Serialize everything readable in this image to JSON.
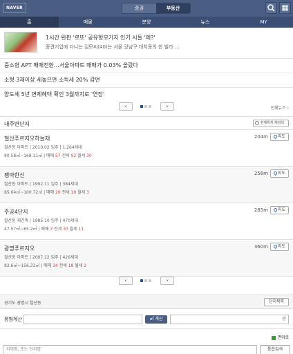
{
  "header": {
    "logo": "NAVER",
    "segment": [
      "증권",
      "부동산"
    ],
    "icons": [
      "search-icon",
      "grid-menu-icon"
    ]
  },
  "tabs": [
    "홈",
    "매물",
    "분양",
    "뉴스",
    "MY"
  ],
  "news": {
    "featured_title": "1시간 완판 '로또' 공유형모기지 인기 시들 '왜?'",
    "featured_sub": "중견기업에 다니는 김모씨(40)는 서울 강남구 대치동의 한 빌라 ...",
    "headlines": [
      "중소형 APT 매매전환…서울아파트 매매가 0.03% 올랐다",
      "소형 3채이상 세놓으면 소득세 20% 감면",
      "양도세 5년 면제혜택 확인 3월까지로 '연장'"
    ],
    "more": "전체뉴스"
  },
  "section": {
    "title": "내주변단지",
    "loc_button": "현재위치 재검색"
  },
  "complexes": [
    {
      "name": "철산푸르지오하늘채",
      "type": "철산동 아파트",
      "date": "2010.02 입주",
      "units": "1,264세대",
      "area": "80.58㎡~168.11㎡",
      "sale_label": "매매",
      "sale": "57",
      "jeonse_label": "전세",
      "jeonse": "92",
      "wolse_label": "월세",
      "wolse": "30",
      "dist": "204m",
      "map": "지도"
    },
    {
      "name": "팽마한신",
      "type": "철산동 아파트",
      "date": "1992.11 입주",
      "units": "384세대",
      "area": "85.64㎡~100.72㎡",
      "sale_label": "매매",
      "sale": "20",
      "jeonse_label": "전세",
      "jeonse": "19",
      "wolse_label": "월세",
      "wolse": "3",
      "dist": "256m",
      "map": "지도"
    },
    {
      "name": "주공4단지",
      "type": "철산동 재건축",
      "date": "1985.10 입주",
      "units": "470세대",
      "area": "47.57㎡~65.2㎡",
      "sale_label": "매매",
      "sale": "7",
      "jeonse_label": "전세",
      "jeonse": "30",
      "wolse_label": "월세",
      "wolse": "11",
      "dist": "285m",
      "map": "지도"
    },
    {
      "name": "광명푸르지오",
      "type": "철산동 아파트",
      "date": "2007.12 입주",
      "units": "426세대",
      "area": "82.6㎡~156.23㎡",
      "sale_label": "매매",
      "sale": "34",
      "jeonse_label": "전세",
      "jeonse": "18",
      "wolse_label": "월세",
      "wolse": "2",
      "dist": "360m",
      "map": "지도"
    }
  ],
  "footer": {
    "address": "경기도 광명시 철산동",
    "list_button": "단지목록",
    "calc_label": "평형계산",
    "calc_button": "㎡ 계산",
    "pyeong_unit": "평",
    "option": "면위로",
    "search_placeholder": "지역명, 또는 단지명",
    "search_button": "통합검색"
  },
  "colors": {
    "header": "#4a5d82",
    "tabbar": "#3b4e73",
    "accent_red": "#e03a3a"
  }
}
